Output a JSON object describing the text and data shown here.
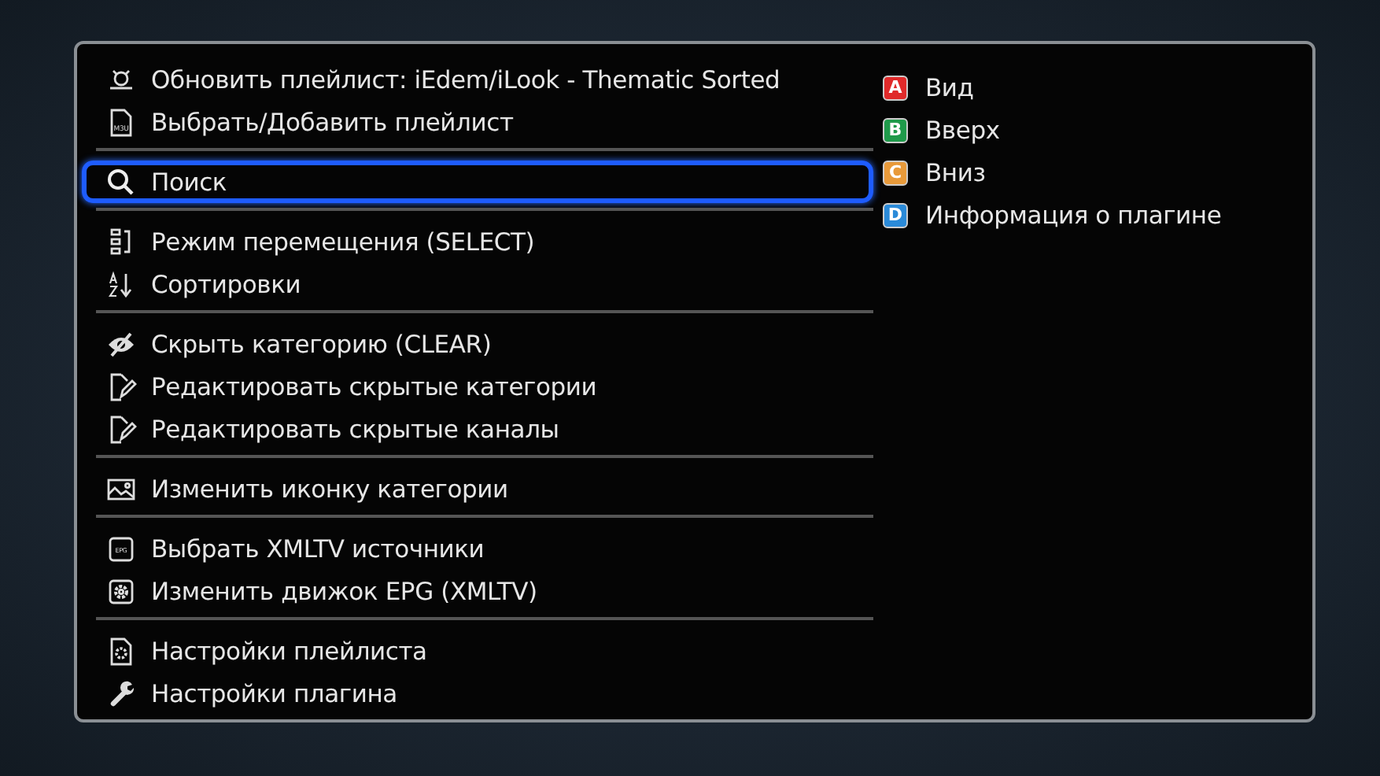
{
  "menu": {
    "groups": [
      {
        "items": [
          {
            "kind": "logo",
            "label": "Обновить плейлист: iEdem/iLook - Thematic Sorted",
            "selected": false
          },
          {
            "kind": "file",
            "icon_text": "M3U",
            "label": "Выбрать/Добавить плейлист",
            "selected": false
          }
        ]
      },
      {
        "items": [
          {
            "kind": "search",
            "label": "Поиск",
            "selected": true
          }
        ]
      },
      {
        "items": [
          {
            "kind": "move",
            "label": "Режим перемещения (SELECT)",
            "selected": false
          },
          {
            "kind": "sort",
            "label": "Сортировки",
            "selected": false
          }
        ]
      },
      {
        "items": [
          {
            "kind": "hide",
            "label": "Скрыть категорию (CLEAR)",
            "selected": false
          },
          {
            "kind": "edit",
            "label": "Редактировать скрытые категории",
            "selected": false
          },
          {
            "kind": "edit",
            "label": "Редактировать скрытые каналы",
            "selected": false
          }
        ]
      },
      {
        "items": [
          {
            "kind": "image",
            "label": "Изменить иконку категории",
            "selected": false
          }
        ]
      },
      {
        "items": [
          {
            "kind": "epg",
            "icon_text": "EPG",
            "label": "Выбрать XMLTV источники",
            "selected": false
          },
          {
            "kind": "gearbox",
            "label": "Изменить движок EPG (XMLTV)",
            "selected": false
          }
        ]
      },
      {
        "items": [
          {
            "kind": "gearfile",
            "label": "Настройки плейлиста",
            "selected": false
          },
          {
            "kind": "wrench",
            "label": "Настройки плагина",
            "selected": false
          }
        ]
      }
    ]
  },
  "color_keys": [
    {
      "key": "A",
      "color": "#e02a2a",
      "label": "Вид"
    },
    {
      "key": "B",
      "color": "#1f9a4a",
      "label": "Вверх"
    },
    {
      "key": "C",
      "color": "#e89a3a",
      "label": "Вниз"
    },
    {
      "key": "D",
      "color": "#2a8ad8",
      "label": "Информация о плагине"
    }
  ]
}
